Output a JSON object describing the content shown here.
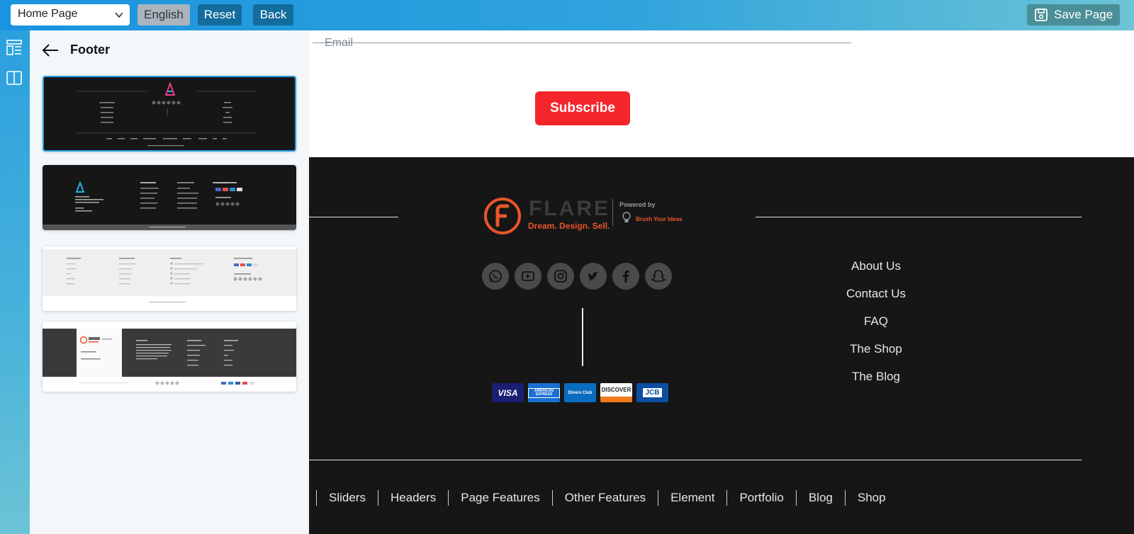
{
  "topbar": {
    "page_select": "Home Page",
    "language": "English",
    "reset": "Reset",
    "back": "Back",
    "save": "Save Page"
  },
  "panel": {
    "title": "Footer"
  },
  "preview": {
    "email_placeholder": "Email",
    "subscribe": "Subscribe",
    "brand_name": "FLARE",
    "brand_tagline": "Dream. Design. Sell.",
    "powered_by": "Powered by",
    "powered_brand": "Brush Your Ideas",
    "socials": [
      "whatsapp-icon",
      "youtube-icon",
      "instagram-icon",
      "twitter-icon",
      "facebook-icon",
      "snapchat-icon"
    ],
    "payments": [
      "VISA",
      "AMERICAN EXPRESS",
      "Diners Club",
      "DISCOVER",
      "JCB"
    ],
    "links": [
      "About Us",
      "Contact Us",
      "FAQ",
      "The Shop",
      "The Blog"
    ],
    "bottom_nav": [
      "Sliders",
      "Headers",
      "Page Features",
      "Other Features",
      "Element",
      "Portfolio",
      "Blog",
      "Shop"
    ]
  }
}
